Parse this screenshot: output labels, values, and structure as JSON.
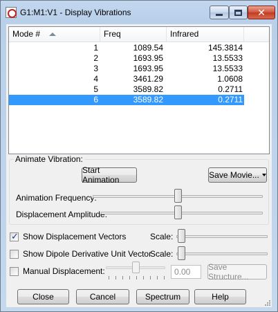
{
  "window": {
    "title": "G1:M1:V1 - Display Vibrations",
    "close_glyph": "✕"
  },
  "table": {
    "headers": [
      "Mode #",
      "Freq",
      "Infrared"
    ],
    "rows": [
      {
        "mode": "1",
        "freq": "1089.54",
        "ir": "145.3814"
      },
      {
        "mode": "2",
        "freq": "1693.95",
        "ir": "13.5533"
      },
      {
        "mode": "3",
        "freq": "1693.95",
        "ir": "13.5533"
      },
      {
        "mode": "4",
        "freq": "3461.29",
        "ir": "1.0608"
      },
      {
        "mode": "5",
        "freq": "3589.82",
        "ir": "0.2711"
      },
      {
        "mode": "6",
        "freq": "3589.82",
        "ir": "0.2711"
      }
    ],
    "selected_row_index": 5
  },
  "animate": {
    "group_label": "Animate Vibration:",
    "start_button": "Start Animation",
    "save_movie_button": "Save Movie...",
    "frequency_label": "Animation Frequency:",
    "frequency_level": 0.5,
    "amplitude_label": "Displacement Amplitude:",
    "amplitude_level": 0.5
  },
  "options": {
    "show_vectors_label": "Show Displacement Vectors",
    "show_vectors_checked": true,
    "show_dipole_label": "Show Dipole Derivative Unit Vector",
    "show_dipole_checked": false,
    "scale_label": "Scale:",
    "vector_scale_level": 0.0,
    "dipole_scale_level": 0.0,
    "manual_label": "Manual Displacement:",
    "manual_checked": false,
    "manual_level": 0.5,
    "manual_value": "0.00",
    "save_structure_button": "Save Structure..."
  },
  "footer": {
    "close_button": "Close",
    "cancel_button": "Cancel",
    "spectrum_button": "Spectrum",
    "help_button": "Help"
  },
  "colors": {
    "selection": "#3399ff",
    "window_frame": "#c3d7ef",
    "close_button": "#c03a22"
  },
  "icons": [
    "app-icon",
    "minimize-icon",
    "maximize-icon",
    "close-icon",
    "sort-ascending-icon",
    "dropdown-arrow-icon",
    "size-grip-icon"
  ]
}
